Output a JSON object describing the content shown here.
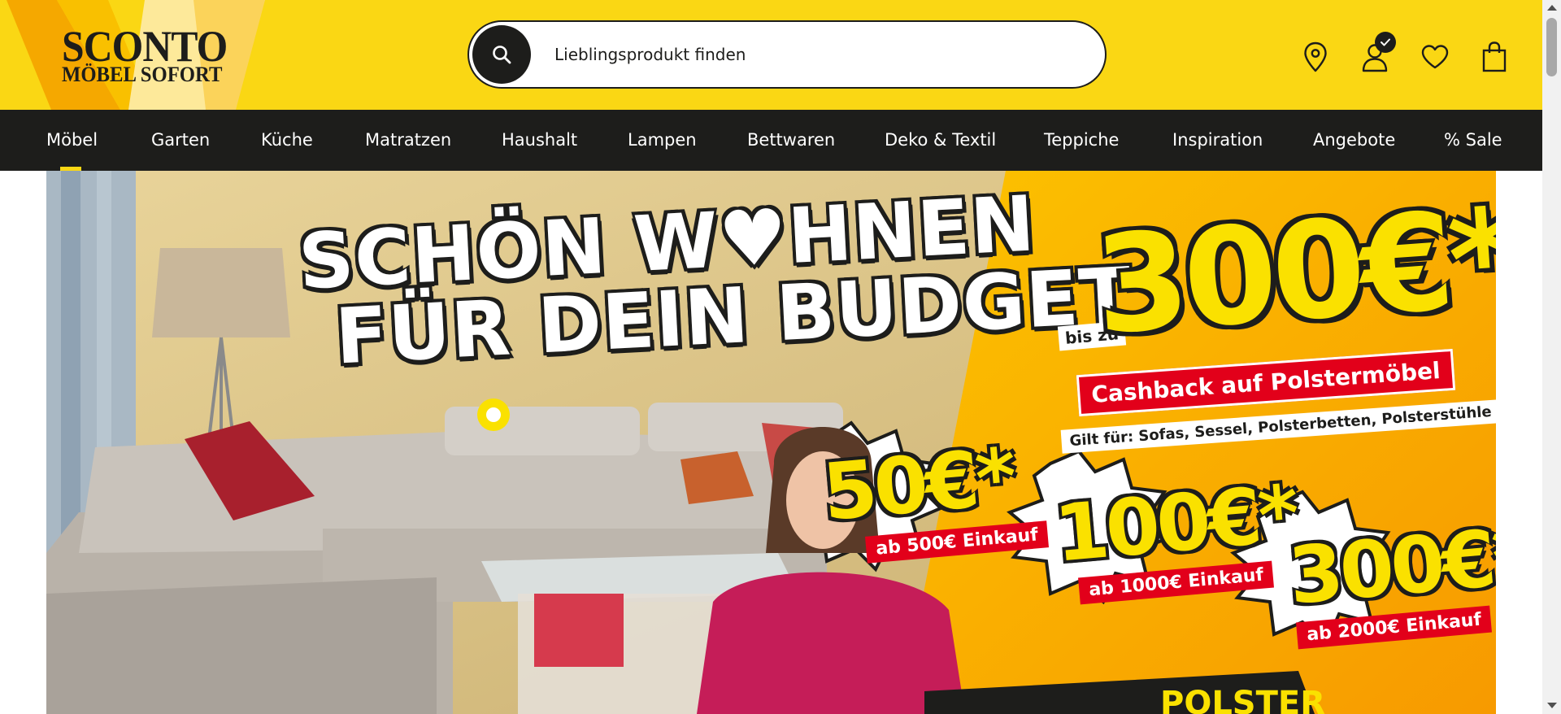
{
  "header": {
    "logo": {
      "line1": "SCONTO",
      "line2": "MÖBEL SOFORT"
    },
    "search": {
      "placeholder": "Lieblingsprodukt finden"
    },
    "icons": [
      "location-pin-icon",
      "user-account-icon",
      "heart-icon",
      "shopping-bag-icon"
    ]
  },
  "nav": {
    "items": [
      {
        "label": "Möbel",
        "active": true
      },
      {
        "label": "Garten"
      },
      {
        "label": "Küche"
      },
      {
        "label": "Matratzen"
      },
      {
        "label": "Haushalt"
      },
      {
        "label": "Lampen"
      },
      {
        "label": "Bettwaren"
      },
      {
        "label": "Deko & Textil"
      },
      {
        "label": "Teppiche"
      },
      {
        "label": "Inspiration"
      },
      {
        "label": "Angebote"
      },
      {
        "label": "% Sale"
      }
    ]
  },
  "hero": {
    "headline_line1": "SCHÖN W♥HNEN",
    "headline_line2": "FÜR DEIN BUDGET",
    "prefix": "bis zu",
    "main_amount": "300€*",
    "cashback_label": "Cashback auf Polstermöbel",
    "valid_for": "Gilt für: Sofas, Sessel, Polsterbetten, Polsterstühle",
    "tiers": [
      {
        "amount": "50€*",
        "condition": "ab 500€ Einkauf"
      },
      {
        "amount": "100€*",
        "condition": "ab 1000€ Einkauf"
      },
      {
        "amount": "300€*",
        "condition": "ab 2000€ Einkauf"
      }
    ],
    "bottom_text": "POLSTER"
  },
  "colors": {
    "brand_yellow": "#fad714",
    "nav_black": "#1d1d1b",
    "accent_red": "#e2001a",
    "hero_orange": "#fbb400"
  }
}
